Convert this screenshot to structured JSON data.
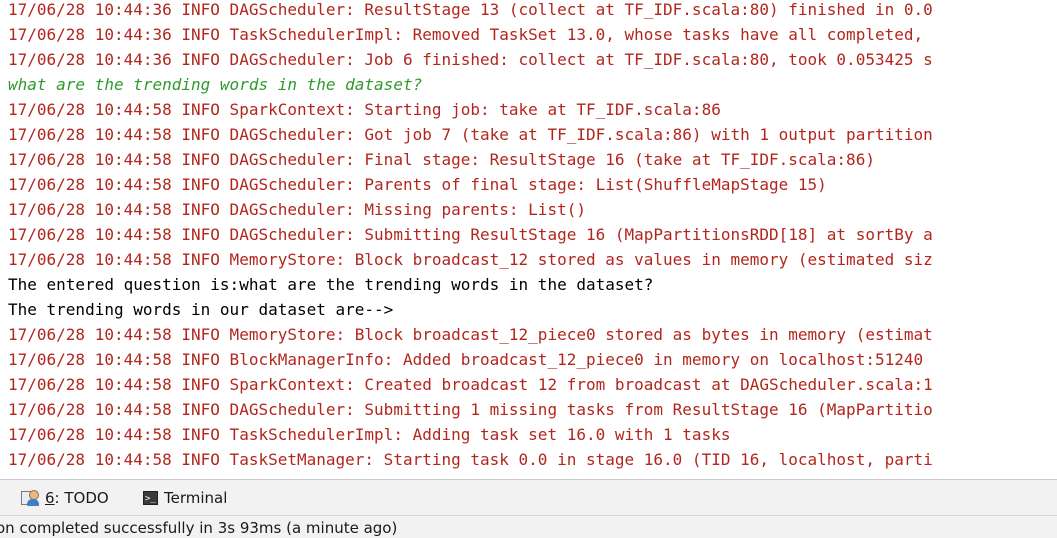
{
  "console": {
    "lines": [
      {
        "text": "17/06/28 10:44:36 INFO DAGScheduler: ResultStage 13 (collect at TF_IDF.scala:80) finished in 0.0",
        "kind": "err"
      },
      {
        "text": "17/06/28 10:44:36 INFO TaskSchedulerImpl: Removed TaskSet 13.0, whose tasks have all completed,",
        "kind": "err"
      },
      {
        "text": "17/06/28 10:44:36 INFO DAGScheduler: Job 6 finished: collect at TF_IDF.scala:80, took 0.053425 s",
        "kind": "err"
      },
      {
        "text": "what are the trending words in the dataset?",
        "kind": "usr"
      },
      {
        "text": "17/06/28 10:44:58 INFO SparkContext: Starting job: take at TF_IDF.scala:86",
        "kind": "err"
      },
      {
        "text": "17/06/28 10:44:58 INFO DAGScheduler: Got job 7 (take at TF_IDF.scala:86) with 1 output partition",
        "kind": "err"
      },
      {
        "text": "17/06/28 10:44:58 INFO DAGScheduler: Final stage: ResultStage 16 (take at TF_IDF.scala:86)",
        "kind": "err"
      },
      {
        "text": "17/06/28 10:44:58 INFO DAGScheduler: Parents of final stage: List(ShuffleMapStage 15)",
        "kind": "err"
      },
      {
        "text": "17/06/28 10:44:58 INFO DAGScheduler: Missing parents: List()",
        "kind": "err"
      },
      {
        "text": "17/06/28 10:44:58 INFO DAGScheduler: Submitting ResultStage 16 (MapPartitionsRDD[18] at sortBy a",
        "kind": "err"
      },
      {
        "text": "17/06/28 10:44:58 INFO MemoryStore: Block broadcast_12 stored as values in memory (estimated siz",
        "kind": "err"
      },
      {
        "text": "The entered question is:what are the trending words in the dataset?",
        "kind": "out"
      },
      {
        "text": "The trending words in our dataset are-->",
        "kind": "out"
      },
      {
        "text": "17/06/28 10:44:58 INFO MemoryStore: Block broadcast_12_piece0 stored as bytes in memory (estimat",
        "kind": "err"
      },
      {
        "text": "17/06/28 10:44:58 INFO BlockManagerInfo: Added broadcast_12_piece0 in memory on localhost:51240",
        "kind": "err"
      },
      {
        "text": "17/06/28 10:44:58 INFO SparkContext: Created broadcast 12 from broadcast at DAGScheduler.scala:1",
        "kind": "err"
      },
      {
        "text": "17/06/28 10:44:58 INFO DAGScheduler: Submitting 1 missing tasks from ResultStage 16 (MapPartitio",
        "kind": "err"
      },
      {
        "text": "17/06/28 10:44:58 INFO TaskSchedulerImpl: Adding task set 16.0 with 1 tasks",
        "kind": "err"
      },
      {
        "text": "17/06/28 10:44:58 INFO TaskSetManager: Starting task 0.0 in stage 16.0 (TID 16, localhost, parti",
        "kind": "err"
      }
    ]
  },
  "tool_strip": {
    "todo_number": "6",
    "todo_label": ": TODO",
    "terminal_label": "Terminal"
  },
  "status_bar": {
    "text": "on completed successfully in 3s 93ms (a minute ago)"
  },
  "colors": {
    "log_red": "#b3261e",
    "user_input_green": "#2e9a2e",
    "output_black": "#000000"
  },
  "icons": {
    "todo": "todo-user-icon",
    "terminal": "terminal-icon"
  }
}
